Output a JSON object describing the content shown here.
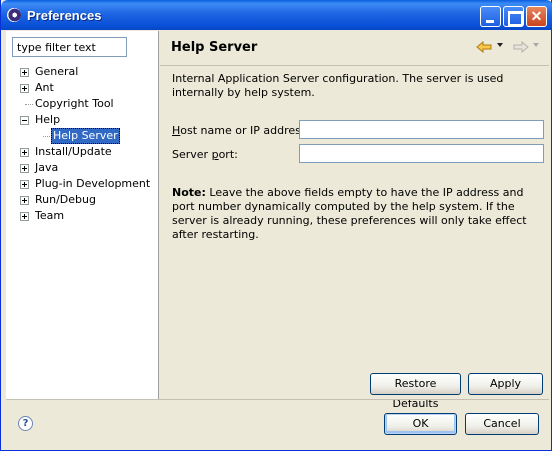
{
  "window": {
    "title": "Preferences"
  },
  "filter": {
    "value": "type filter text"
  },
  "tree": [
    {
      "label": "General",
      "expander": "plus"
    },
    {
      "label": "Ant",
      "expander": "plus"
    },
    {
      "label": "Copyright Tool",
      "expander": "none"
    },
    {
      "label": "Help",
      "expander": "minus"
    },
    {
      "label": "Help Server",
      "expander": "child",
      "selected": true
    },
    {
      "label": "Install/Update",
      "expander": "plus"
    },
    {
      "label": "Java",
      "expander": "plus"
    },
    {
      "label": "Plug-in Development",
      "expander": "plus"
    },
    {
      "label": "Run/Debug",
      "expander": "plus"
    },
    {
      "label": "Team",
      "expander": "plus"
    }
  ],
  "page": {
    "title": "Help Server",
    "description": "Internal Application Server configuration.  The server is used internally by help system.",
    "host_label_prefix": "H",
    "host_label_rest": "ost name or IP address:",
    "host_value": "",
    "port_label_prefix": "Server ",
    "port_label_underline": "p",
    "port_label_rest": "ort:",
    "port_value": "",
    "note_bold": "Note:",
    "note_text": " Leave the above fields empty to have the IP address and port number dynamically computed by the help system. If the server is already running, these preferences will only take effect after restarting.",
    "restore_defaults": "Restore Defaults",
    "apply": "Apply"
  },
  "footer": {
    "help_icon": "?",
    "ok": "OK",
    "cancel": "Cancel"
  },
  "icons": {
    "back": "arrow-left-icon",
    "forward": "arrow-right-icon"
  },
  "colors": {
    "titlebar": "#0a5fe0",
    "selection": "#316ac5",
    "dialog_bg": "#ece9d8",
    "back_arrow": "#f2b33d"
  }
}
